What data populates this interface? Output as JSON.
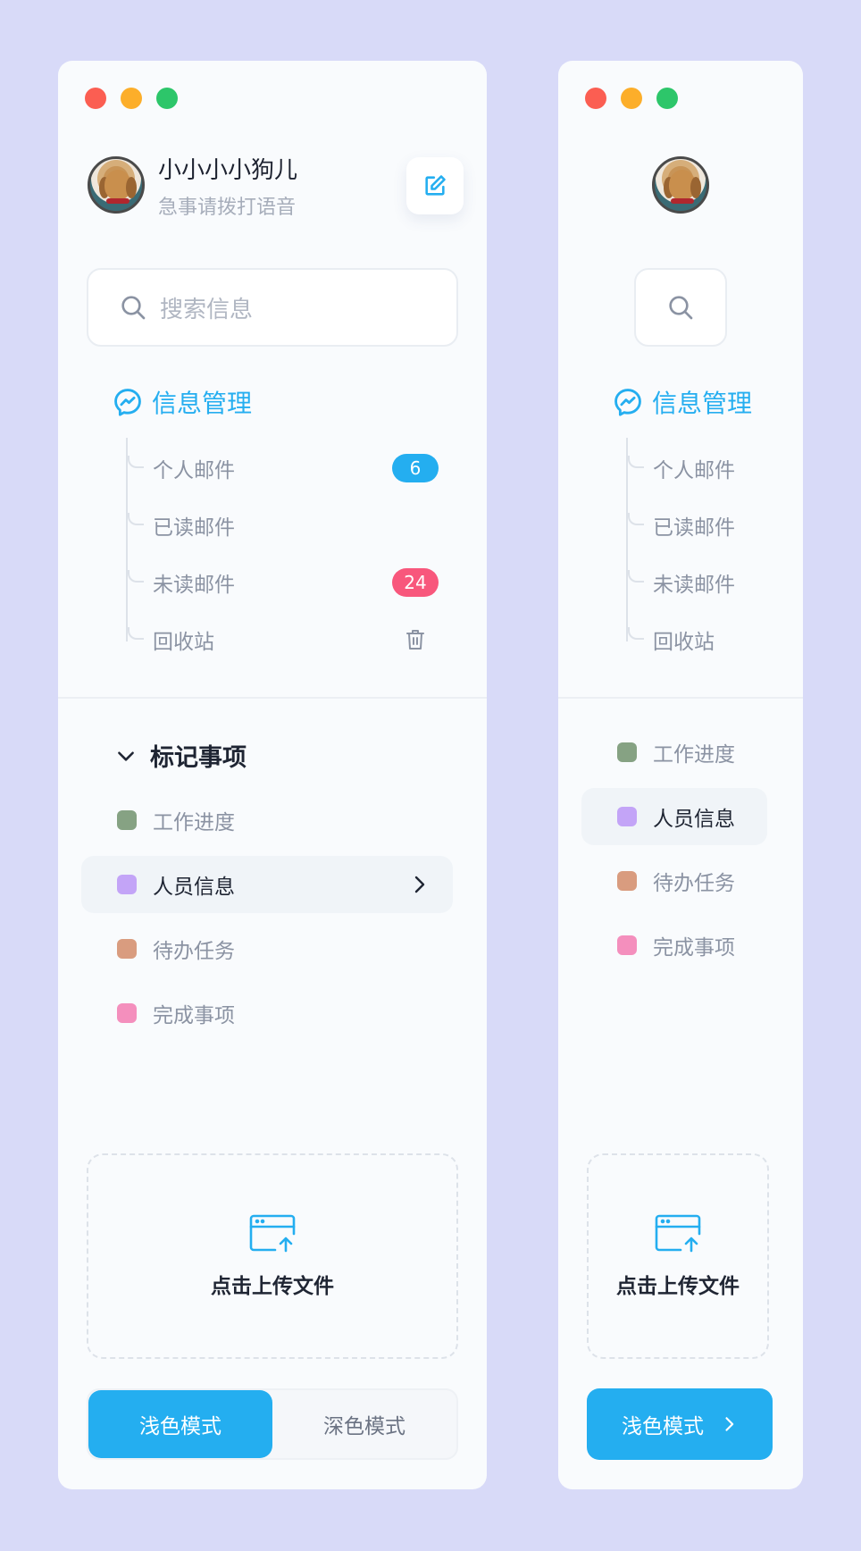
{
  "colors": {
    "background": "#d8daf8",
    "panel": "#f9fbfd",
    "accent": "#24aef0",
    "badge_red": "#f8577c",
    "window_red": "#fb5e52",
    "window_yellow": "#fcae2a",
    "window_green": "#2dc66a"
  },
  "user": {
    "name": "小小小小狗儿",
    "status": "急事请拨打语音"
  },
  "search": {
    "placeholder": "搜索信息"
  },
  "messages": {
    "title": "信息管理",
    "items": [
      {
        "label": "个人邮件",
        "badge": "6",
        "badge_color": "#24aef0"
      },
      {
        "label": "已读邮件"
      },
      {
        "label": "未读邮件",
        "badge": "24",
        "badge_color": "#f8577c"
      },
      {
        "label": "回收站",
        "icon": "trash-icon"
      }
    ]
  },
  "marks": {
    "title": "标记事项",
    "items": [
      {
        "label": "工作进度",
        "color": "#86a283"
      },
      {
        "label": "人员信息",
        "color": "#c3a4f7",
        "active": true
      },
      {
        "label": "待办任务",
        "color": "#d99c7f"
      },
      {
        "label": "完成事项",
        "color": "#f48fbd"
      }
    ]
  },
  "upload": {
    "label": "点击上传文件"
  },
  "mode": {
    "light": "浅色模式",
    "dark": "深色模式",
    "selected": "light"
  }
}
